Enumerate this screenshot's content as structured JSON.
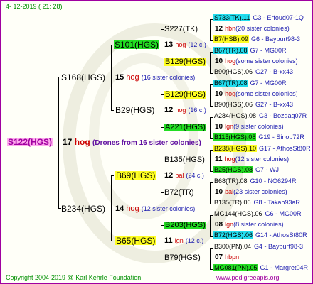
{
  "header": {
    "date": "4- 12-2019 ( 21: 28)"
  },
  "footer": {
    "copyright": "Copyright 2004-2019 @ Karl Kehrle Foundation",
    "site": "www.pedigreeapis.org"
  },
  "root": {
    "name": "S122(HGS)",
    "year": "17",
    "hog": "hog",
    "note": "(Drones from 16 sister colonies)"
  },
  "gen1": [
    {
      "name": "S168(HGS)",
      "year": "15",
      "hog": "hog",
      "note": "(16 sister colonies)"
    },
    {
      "name": "B234(HGS)",
      "year": "14",
      "hog": "hog",
      "note": "(12 sister colonies)"
    }
  ],
  "gen2": [
    {
      "name": "S101(HGS)",
      "year": "13",
      "hog": "hog",
      "note": "(12 c.)"
    },
    {
      "name": "B29(HGS)",
      "year": "12",
      "hog": "hog",
      "note": "(16 c.)"
    },
    {
      "name": "B69(HGS)",
      "year": "12",
      "hog": "bal",
      "note": "(24 c.)"
    },
    {
      "name": "B65(HGS)",
      "year": "11",
      "hog": "lgn",
      "note": "(12 c.)"
    }
  ],
  "gen3": [
    {
      "name": "S227(TK)"
    },
    {
      "name": "B129(HGS)"
    },
    {
      "name": "B129(HGS)"
    },
    {
      "name": "A221(HGS)"
    },
    {
      "name": "B135(HGS)"
    },
    {
      "name": "B72(TR)"
    },
    {
      "name": "B203(HGS)"
    },
    {
      "name": "B79(HGS)"
    }
  ],
  "gen4": [
    {
      "a": "S733(TK).11",
      "a_note": "G3 - Erfoud07-1Q",
      "b_year": "12",
      "b_text": "hbn",
      "b_note": "(20 sister colonies)",
      "c": "B7(HSB).09",
      "c_note": "G6 - Bayburt98-3"
    },
    {
      "a": "B67(TR).08",
      "a_note": "G7 - MG00R",
      "b_year": "10",
      "b_text": "hog",
      "b_note": "(some sister colonies)",
      "c": "B90(HGS).06",
      "c_note": "G27 - B-xx43"
    },
    {
      "a": "B67(TR).08",
      "a_note": "G7 - MG00R",
      "b_year": "10",
      "b_text": "hog",
      "b_note": "(some sister colonies)",
      "c": "B90(HGS).06",
      "c_note": "G27 - B-xx43"
    },
    {
      "a": "A284(HGS).08",
      "a_note": "G3 - Bozdag07R",
      "b_year": "10",
      "b_text": "lgn",
      "b_note": "(9 sister colonies)",
      "c": "B115(HGS).08",
      "c_note": "G19 - Sinop72R"
    },
    {
      "a": "B238(HGS).10",
      "a_note": "G17 - AthosSt80R",
      "b_year": "11",
      "b_text": "hog",
      "b_note": "(12 sister colonies)",
      "c": "B25(HGS).08",
      "c_note": "G7 - WJ"
    },
    {
      "a": "B68(TR).08",
      "a_note": "G10 - NO6294R",
      "b_year": "10",
      "b_text": "bal",
      "b_note": "(23 sister colonies)",
      "c": "B135(TR).06",
      "c_note": "G8 - Takab93aR"
    },
    {
      "a": "MG144(HGS).06",
      "a_note": "G6 - MG00R",
      "b_year": "08",
      "b_text": "lgn",
      "b_note": "(8 sister colonies)",
      "c": "B72(HGS).06",
      "c_note": "G14 - AthosSt80R"
    },
    {
      "a": "B300(PN).04",
      "a_note": "G4 - Bayburt98-3",
      "b_year": "07",
      "b_text": "hbpn",
      "b_note": "",
      "c": "MG081(PN).05",
      "c_note": "G1 - Margret04R"
    }
  ],
  "colors": {
    "border": "#a000a0",
    "green": "#22dd22",
    "yellow": "#ffff22",
    "cyan": "#22ddee",
    "pink": "#ffaaee",
    "hog": "#cc0000",
    "note": "#2020b0"
  }
}
